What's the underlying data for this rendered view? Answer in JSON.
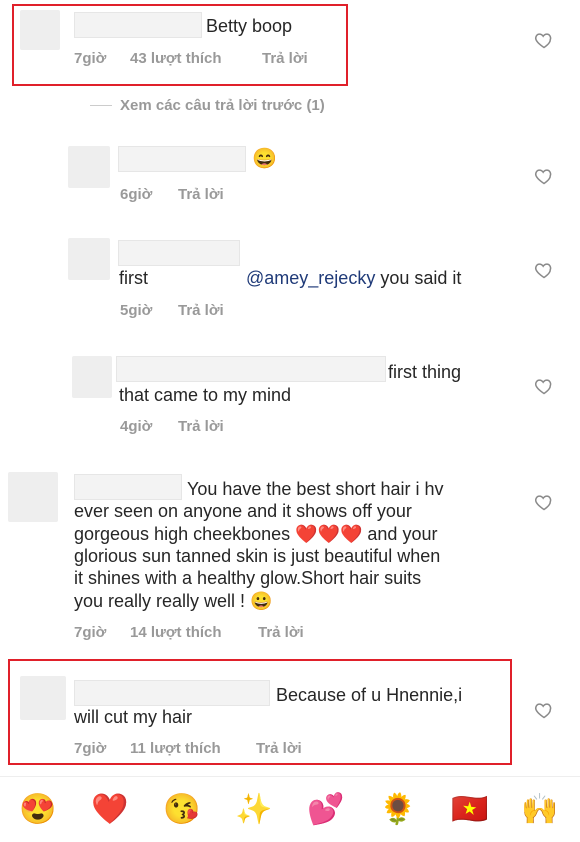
{
  "comments": [
    {
      "text": "Betty boop",
      "time": "7giờ",
      "likes": "43 lượt thích",
      "reply": "Trả lời"
    },
    {
      "text": "😄",
      "time": "6giờ",
      "reply": "Trả lời"
    },
    {
      "mention": "@amey_rejecky",
      "text": " you said it",
      "text2": "first",
      "time": "5giờ",
      "reply": "Trả lời"
    },
    {
      "text": "first thing",
      "text2": "that came to my mind",
      "time": "4giờ",
      "reply": "Trả lời"
    },
    {
      "text": "You have the best short hair i hv",
      "text2": "ever seen on anyone and it shows off your",
      "text3": "gorgeous high cheekbones ❤️❤️❤️ and your",
      "text4": "glorious sun tanned skin is just beautiful when",
      "text5": "it shines with a healthy glow.Short hair suits",
      "text6": "you really really well ! 😀",
      "time": "7giờ",
      "likes": "14 lượt thích",
      "reply": "Trả lời"
    },
    {
      "text": "Because of u Hnennie,i",
      "text2": "will cut my hair",
      "time": "7giờ",
      "likes": "11 lượt thích",
      "reply": "Trả lời"
    }
  ],
  "view_previous": "Xem các câu trả lời trước (1)",
  "emoji_bar": [
    "😍",
    "❤️",
    "😘",
    "✨",
    "💕",
    "🌻",
    "🇻🇳",
    "🙌"
  ],
  "colors": {
    "highlight_border": "#e0202a",
    "meta_text": "#999999",
    "mention": "#1f3a78"
  }
}
